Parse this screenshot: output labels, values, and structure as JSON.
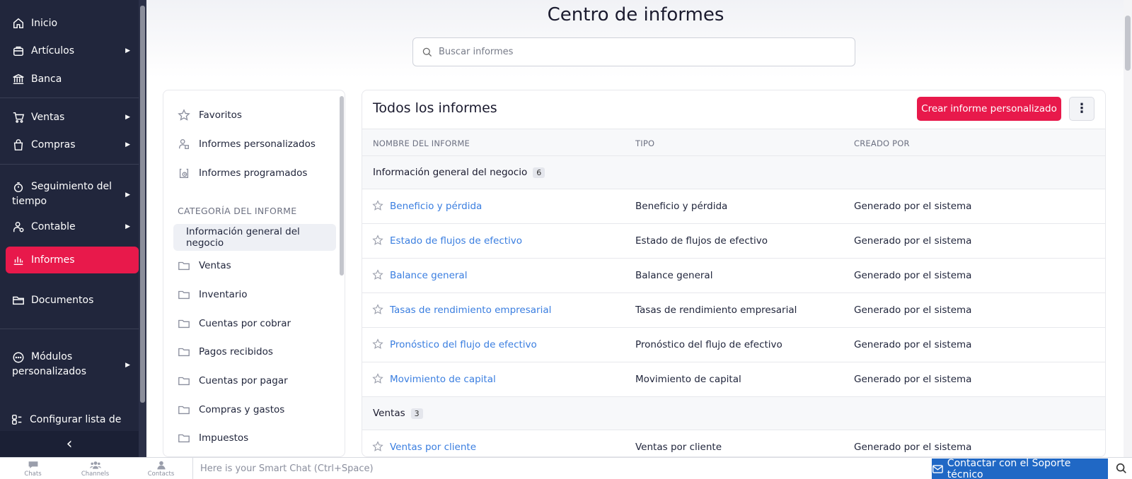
{
  "sidebar": {
    "items": [
      {
        "label": "Inicio",
        "icon": "home-icon"
      },
      {
        "label": "Artículos",
        "icon": "bag-icon",
        "caret": "▶"
      },
      {
        "label": "Banca",
        "icon": "bank-icon"
      },
      {
        "label": "Ventas",
        "icon": "cart-icon",
        "caret": "▶"
      },
      {
        "label": "Compras",
        "icon": "shopping-bag-icon",
        "caret": "▶"
      },
      {
        "label_line1": "Seguimiento del",
        "label_line2": "tiempo",
        "icon": "stopwatch-icon",
        "caret": "▶"
      },
      {
        "label": "Contable",
        "icon": "accountant-icon",
        "caret": "▶"
      },
      {
        "label": "Informes",
        "icon": "bar-chart-icon",
        "active": true
      },
      {
        "label": "Documentos",
        "icon": "folder-icon"
      },
      {
        "label_line1": "Módulos",
        "label_line2": "personalizados",
        "icon": "more-circle-icon",
        "caret": "▶"
      },
      {
        "label": "Configurar lista de",
        "icon": "configure-icon"
      }
    ],
    "collapse_glyph": "‹",
    "colors": {
      "background": "#21263c",
      "active": "#e8194b"
    }
  },
  "header": {
    "title": "Centro de informes",
    "search_placeholder": "Buscar informes"
  },
  "categories": {
    "top_items": [
      {
        "label": "Favoritos",
        "icon": "star-icon"
      },
      {
        "label": "Informes personalizados",
        "icon": "user-report-icon"
      },
      {
        "label": "Informes programados",
        "icon": "scheduled-icon"
      }
    ],
    "heading": "CATEGORÍA DEL INFORME",
    "active": "Información general del negocio",
    "folders": [
      "Ventas",
      "Inventario",
      "Cuentas por cobrar",
      "Pagos recibidos",
      "Cuentas por pagar",
      "Compras y gastos",
      "Impuestos"
    ]
  },
  "reports": {
    "title": "Todos los informes",
    "create_label": "Crear informe personalizado",
    "more_glyph": "⋮",
    "columns": [
      "NOMBRE DEL INFORME",
      "TIPO",
      "CREADO POR"
    ],
    "groups": [
      {
        "name": "Información general del negocio",
        "count": "6",
        "rows": [
          {
            "name": "Beneficio y pérdida",
            "type": "Beneficio y pérdida",
            "by": "Generado por el sistema"
          },
          {
            "name": "Estado de flujos de efectivo",
            "type": "Estado de flujos de efectivo",
            "by": "Generado por el sistema"
          },
          {
            "name": "Balance general",
            "type": "Balance general",
            "by": "Generado por el sistema"
          },
          {
            "name": "Tasas de rendimiento empresarial",
            "type": "Tasas de rendimiento empresarial",
            "by": "Generado por el sistema"
          },
          {
            "name": "Pronóstico del flujo de efectivo",
            "type": "Pronóstico del flujo de efectivo",
            "by": "Generado por el sistema"
          },
          {
            "name": "Movimiento de capital",
            "type": "Movimiento de capital",
            "by": "Generado por el sistema"
          }
        ]
      },
      {
        "name": "Ventas",
        "count": "3",
        "rows": [
          {
            "name": "Ventas por cliente",
            "type": "Ventas por cliente",
            "by": "Generado por el sistema"
          }
        ]
      }
    ],
    "link_color": "#3a7ee0"
  },
  "bottom_bar": {
    "items": [
      "Chats",
      "Channels",
      "Contacts"
    ],
    "smart_chat_placeholder": "Here is your Smart Chat (Ctrl+Space)",
    "support_label": "Contactar con el Soporte técnico",
    "support_color": "#2068c5"
  }
}
